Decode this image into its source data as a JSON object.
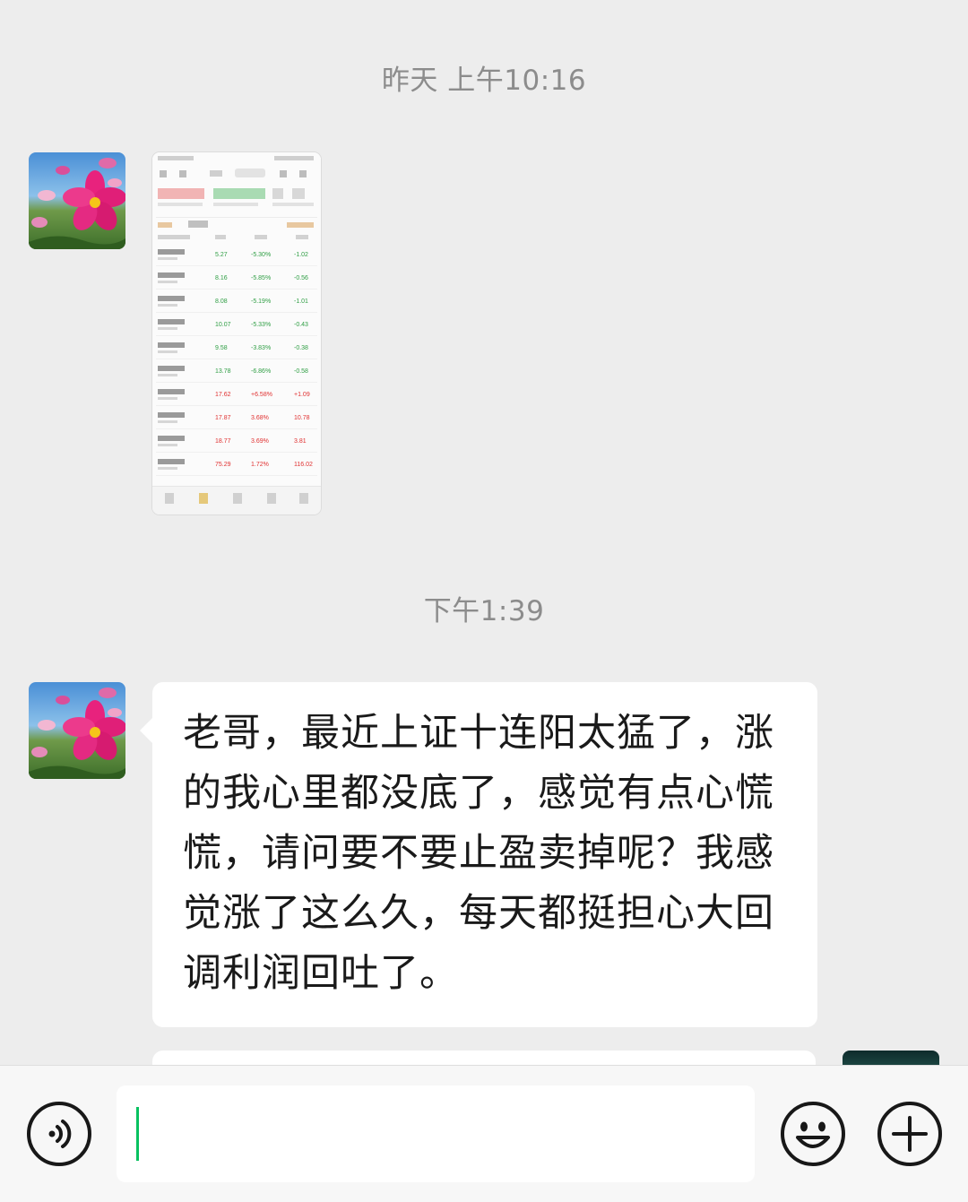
{
  "messages": {
    "timestamp_1": "昨天 上午10:16",
    "timestamp_2": "下午1:39",
    "image_message": {
      "description_icon": "stock-screenshot-thumbnail",
      "rows": [
        {
          "v1": "5.27",
          "v2": "-5.30%",
          "v3": "-1.02",
          "color": "#2f9e44"
        },
        {
          "v1": "8.16",
          "v2": "-5.85%",
          "v3": "-0.56",
          "color": "#2f9e44"
        },
        {
          "v1": "8.08",
          "v2": "-5.19%",
          "v3": "-1.01",
          "color": "#2f9e44"
        },
        {
          "v1": "10.07",
          "v2": "-5.33%",
          "v3": "-0.43",
          "color": "#2f9e44"
        },
        {
          "v1": "9.58",
          "v2": "-3.83%",
          "v3": "-0.38",
          "color": "#2f9e44"
        },
        {
          "v1": "13.78",
          "v2": "-6.86%",
          "v3": "-0.58",
          "color": "#2f9e44"
        },
        {
          "v1": "17.62",
          "v2": "+6.58%",
          "v3": "+1.09",
          "color": "#e03131"
        },
        {
          "v1": "17.87",
          "v2": "3.68%",
          "v3": "10.78",
          "color": "#e03131"
        },
        {
          "v1": "18.77",
          "v2": "3.69%",
          "v3": "3.81",
          "color": "#e03131"
        },
        {
          "v1": "75.29",
          "v2": "1.72%",
          "v3": "116.02",
          "color": "#e03131"
        }
      ]
    },
    "text_message": "老哥，最近上证十连阳太猛了，涨的我心里都没底了，感觉有点心慌慌，请问要不要止盈卖掉呢？我感觉涨了这么久，每天都挺担心大回调利润回吐了。"
  },
  "input_bar": {
    "voice_icon": "voice-icon",
    "emoji_icon": "emoji-icon",
    "plus_icon": "plus-icon",
    "input_value": ""
  },
  "colors": {
    "background": "#ededed",
    "bubble": "#ffffff",
    "caret": "#07c160"
  }
}
